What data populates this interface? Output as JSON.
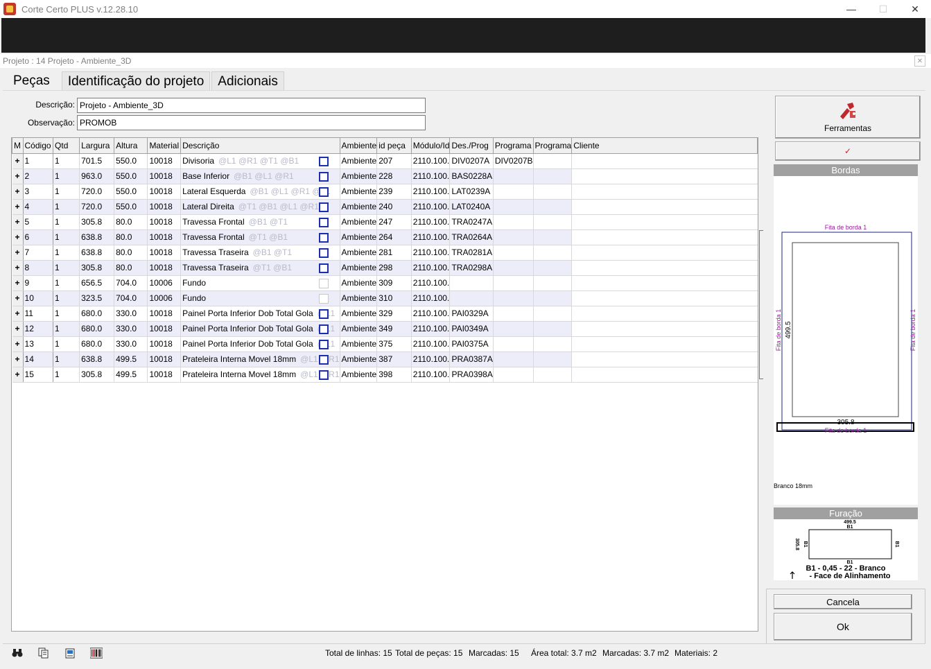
{
  "window": {
    "title": "Corte Certo  PLUS  v.12.28.10",
    "minimize": "—",
    "maximize": "☐",
    "close": "✕"
  },
  "project": {
    "label": "Projeto : 14  Projeto - Ambiente_3D",
    "close": "✕"
  },
  "tabs": [
    {
      "label": "Peças"
    },
    {
      "label": "Identificação do projeto"
    },
    {
      "label": "Adicionais"
    }
  ],
  "form": {
    "descricao_label": "Descrição:",
    "descricao_value": "Projeto - Ambiente_3D",
    "observacao_label": "Observação:",
    "observacao_value": "PROMOB"
  },
  "grid": {
    "columns": [
      "M",
      "Código",
      "Qtd",
      "Largura",
      "Altura",
      "Material",
      "Descrição",
      "Ambiente",
      "id peça",
      "Módulo/Id",
      "Des./Prog",
      "Programa",
      "Programa",
      "Cliente"
    ],
    "rows": [
      {
        "m": "+",
        "codigo": "1",
        "qtd": "1",
        "largura": "701.5",
        "altura": "550.0",
        "material": "10018",
        "descricao": "Divisoria",
        "tags": "@L1 @R1 @T1 @B1",
        "chk": "blue",
        "ambiente": "Ambiente",
        "id": "207",
        "modulo": "2110.100.",
        "desprog": "DIV0207A",
        "prog1": "DIV0207B",
        "prog2": ""
      },
      {
        "m": "+",
        "codigo": "2",
        "qtd": "1",
        "largura": "963.0",
        "altura": "550.0",
        "material": "10018",
        "descricao": "Base Inferior",
        "tags": "@B1 @L1 @R1",
        "chk": "blue",
        "ambiente": "Ambiente",
        "id": "228",
        "modulo": "2110.100.",
        "desprog": "BAS0228A",
        "prog1": "",
        "prog2": ""
      },
      {
        "m": "+",
        "codigo": "3",
        "qtd": "1",
        "largura": "720.0",
        "altura": "550.0",
        "material": "10018",
        "descricao": "Lateral Esquerda",
        "tags": "@B1 @L1 @R1 @T1",
        "chk": "blue",
        "ambiente": "Ambiente",
        "id": "239",
        "modulo": "2110.100.",
        "desprog": "LAT0239A",
        "prog1": "",
        "prog2": ""
      },
      {
        "m": "+",
        "codigo": "4",
        "qtd": "1",
        "largura": "720.0",
        "altura": "550.0",
        "material": "10018",
        "descricao": "Lateral Direita",
        "tags": "@T1 @B1 @L1 @R1",
        "chk": "blue",
        "ambiente": "Ambiente",
        "id": "240",
        "modulo": "2110.100.",
        "desprog": "LAT0240A",
        "prog1": "",
        "prog2": ""
      },
      {
        "m": "+",
        "codigo": "5",
        "qtd": "1",
        "largura": "305.8",
        "altura": "80.0",
        "material": "10018",
        "descricao": "Travessa Frontal",
        "tags": "@B1 @T1",
        "chk": "blue",
        "ambiente": "Ambiente",
        "id": "247",
        "modulo": "2110.100.",
        "desprog": "TRA0247A",
        "prog1": "",
        "prog2": ""
      },
      {
        "m": "+",
        "codigo": "6",
        "qtd": "1",
        "largura": "638.8",
        "altura": "80.0",
        "material": "10018",
        "descricao": "Travessa Frontal",
        "tags": "@T1 @B1",
        "chk": "blue",
        "ambiente": "Ambiente",
        "id": "264",
        "modulo": "2110.100.",
        "desprog": "TRA0264A",
        "prog1": "",
        "prog2": ""
      },
      {
        "m": "+",
        "codigo": "7",
        "qtd": "1",
        "largura": "638.8",
        "altura": "80.0",
        "material": "10018",
        "descricao": "Travessa Traseira",
        "tags": "@B1 @T1",
        "chk": "blue",
        "ambiente": "Ambiente",
        "id": "281",
        "modulo": "2110.100.",
        "desprog": "TRA0281A",
        "prog1": "",
        "prog2": ""
      },
      {
        "m": "+",
        "codigo": "8",
        "qtd": "1",
        "largura": "305.8",
        "altura": "80.0",
        "material": "10018",
        "descricao": "Travessa Traseira",
        "tags": "@T1 @B1",
        "chk": "blue",
        "ambiente": "Ambiente",
        "id": "298",
        "modulo": "2110.100.",
        "desprog": "TRA0298A",
        "prog1": "",
        "prog2": ""
      },
      {
        "m": "+",
        "codigo": "9",
        "qtd": "1",
        "largura": "656.5",
        "altura": "704.0",
        "material": "10006",
        "descricao": "Fundo",
        "tags": "",
        "chk": "light",
        "ambiente": "Ambiente",
        "id": "309",
        "modulo": "2110.100.",
        "desprog": "",
        "prog1": "",
        "prog2": ""
      },
      {
        "m": "+",
        "codigo": "10",
        "qtd": "1",
        "largura": "323.5",
        "altura": "704.0",
        "material": "10006",
        "descricao": "Fundo",
        "tags": "",
        "chk": "light",
        "ambiente": "Ambiente",
        "id": "310",
        "modulo": "2110.100.",
        "desprog": "",
        "prog1": "",
        "prog2": ""
      },
      {
        "m": "+",
        "codigo": "11",
        "qtd": "1",
        "largura": "680.0",
        "altura": "330.0",
        "material": "10018",
        "descricao": "Painel Porta Inferior Dob Total Gola",
        "tags": "@L1",
        "chk": "blue",
        "ambiente": "Ambiente",
        "id": "329",
        "modulo": "2110.100.",
        "desprog": "PAI0329A",
        "prog1": "",
        "prog2": ""
      },
      {
        "m": "+",
        "codigo": "12",
        "qtd": "1",
        "largura": "680.0",
        "altura": "330.0",
        "material": "10018",
        "descricao": "Painel Porta Inferior Dob Total Gola",
        "tags": "@L1",
        "chk": "blue",
        "ambiente": "Ambiente",
        "id": "349",
        "modulo": "2110.100.",
        "desprog": "PAI0349A",
        "prog1": "",
        "prog2": ""
      },
      {
        "m": "+",
        "codigo": "13",
        "qtd": "1",
        "largura": "680.0",
        "altura": "330.0",
        "material": "10018",
        "descricao": "Painel Porta Inferior Dob Total Gola",
        "tags": "@L1",
        "chk": "blue",
        "ambiente": "Ambiente",
        "id": "375",
        "modulo": "2110.100.",
        "desprog": "PAI0375A",
        "prog1": "",
        "prog2": ""
      },
      {
        "m": "+",
        "codigo": "14",
        "qtd": "1",
        "largura": "638.8",
        "altura": "499.5",
        "material": "10018",
        "descricao": "Prateleira Interna Movel 18mm",
        "tags": "@L1 @R1",
        "chk": "blue",
        "ambiente": "Ambiente",
        "id": "387",
        "modulo": "2110.100.",
        "desprog": "PRA0387A",
        "prog1": "",
        "prog2": ""
      },
      {
        "m": "+",
        "codigo": "15",
        "qtd": "1",
        "largura": "305.8",
        "altura": "499.5",
        "material": "10018",
        "descricao": "Prateleira Interna Movel 18mm",
        "tags": "@L1 @R1",
        "chk": "blue",
        "ambiente": "Ambiente",
        "id": "398",
        "modulo": "2110.100.",
        "desprog": "PRA0398A",
        "prog1": "",
        "prog2": ""
      }
    ]
  },
  "right": {
    "ferramentas_label": "Ferramentas",
    "check_glyph": "✓",
    "bordas_title": "Bordas",
    "fita_top": "Fita de borda 1",
    "fita_left": "Fita de borda 1",
    "fita_right": "Fita de borda 1",
    "fita_bottom": "Fita de borda 1",
    "dim_height": "499.5",
    "dim_width": "305.8",
    "material_note": "Branco 18mm",
    "furacao_title": "Furação",
    "fur_top_dim": "499.5",
    "fur_top_label": "B1",
    "fur_bottom_label": "B1",
    "fur_left_dim": "305.8",
    "fur_left_label": "B1",
    "fur_right_label": "B1",
    "fur_legend1": "B1 - 0,45 - 22 - Branco",
    "fur_legend2": "- Face de Alinhamento",
    "cancela_label": "Cancela",
    "ok_label": "Ok"
  },
  "status": {
    "total_linhas": "Total de linhas: 15",
    "total_pecas": "Total de peças: 15",
    "marcadas": "Marcadas: 15",
    "area_total": "Área total: 3.7 m2",
    "marcadas_area": "Marcadas: 3.7 m2",
    "materiais": "Materiais: 2"
  },
  "colors": {
    "checkbox_blue": "#1a2fb0",
    "row_alt": "#ededf9",
    "panel_header": "#a0a0a0",
    "border_line": "#1a237e",
    "fita_text": "#9c1c9c"
  }
}
